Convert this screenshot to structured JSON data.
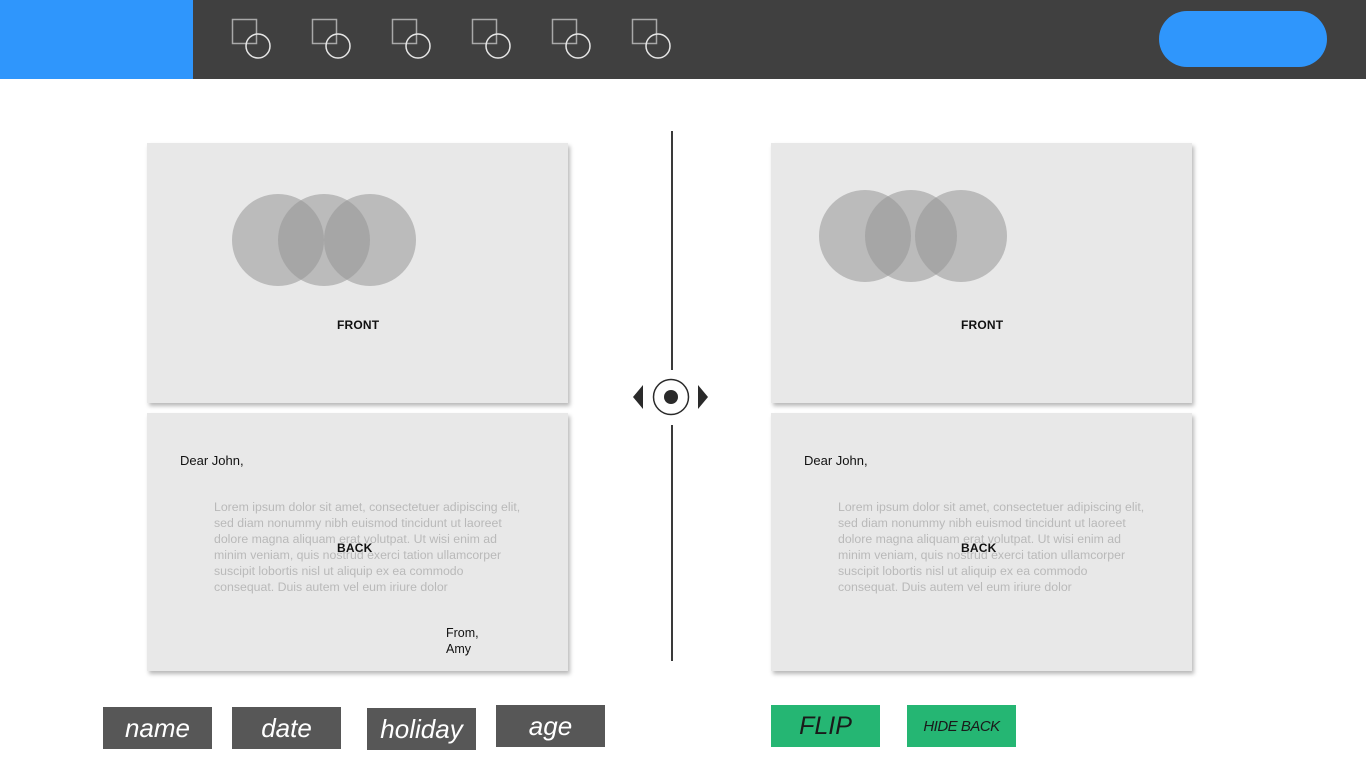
{
  "toolbar": {
    "icons": [
      "shape-tool-1-icon",
      "shape-tool-2-icon",
      "shape-tool-3-icon",
      "shape-tool-4-icon",
      "shape-tool-5-icon",
      "shape-tool-6-icon"
    ]
  },
  "colors": {
    "brand": "#2f96fc",
    "toolbar_bg": "#404040",
    "card_bg": "#e8e8e8",
    "tag_bg": "#575757",
    "action_bg": "#25b673"
  },
  "left_card": {
    "front_label": "FRONT",
    "back_label": "BACK",
    "salutation": "Dear John,",
    "body": "Lorem ipsum dolor sit amet, consectetuer adipiscing elit, sed diam nonummy nibh euismod tincidunt ut laoreet dolore magna aliquam erat volutpat. Ut wisi enim ad minim veniam, quis nostrud exerci tation ullamcorper suscipit lobortis nisl ut aliquip ex ea commodo consequat. Duis autem vel eum iriure dolor",
    "signoff_line1": "From,",
    "signoff_line2": "Amy"
  },
  "right_card": {
    "front_label": "FRONT",
    "back_label": "BACK",
    "salutation": "Dear John,",
    "body": "Lorem ipsum dolor sit amet, consectetuer adipiscing elit, sed diam nonummy nibh euismod tincidunt ut laoreet dolore magna aliquam erat volutpat. Ut wisi enim ad minim veniam, quis nostrud exerci tation ullamcorper suscipit lobortis nisl ut aliquip ex ea commodo consequat. Duis autem vel eum iriure dolor"
  },
  "tags": {
    "name": "name",
    "date": "date",
    "holiday": "holiday",
    "age": "age"
  },
  "actions": {
    "flip": "FLIP",
    "hide_back": "HIDE BACK"
  }
}
